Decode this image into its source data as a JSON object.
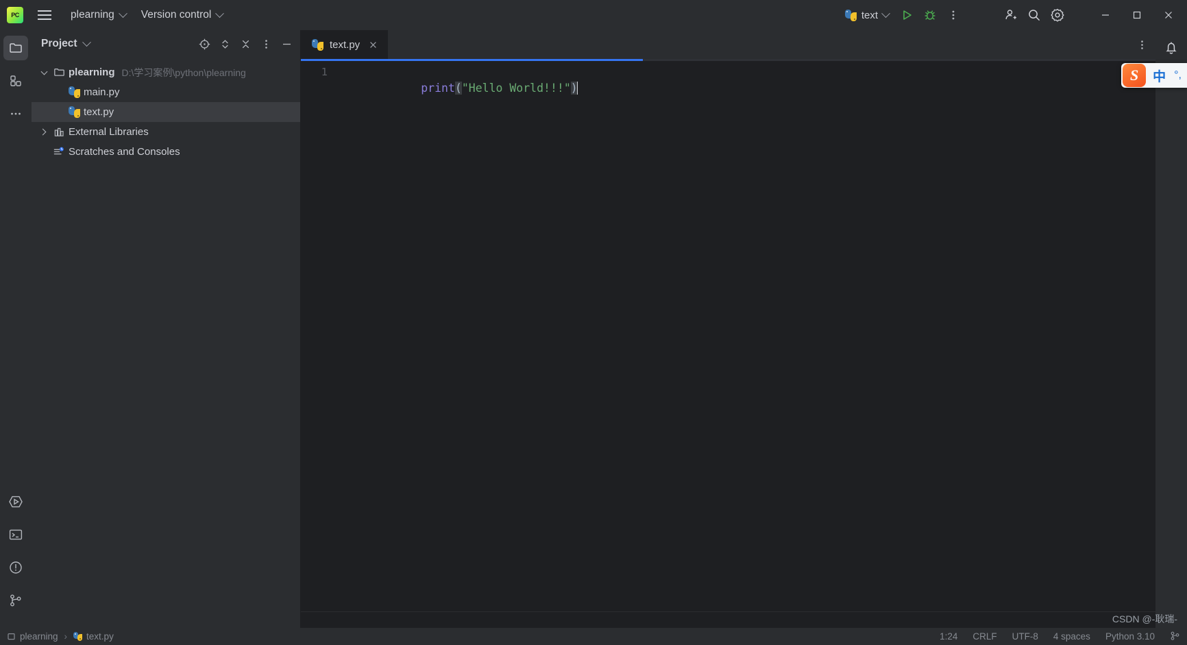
{
  "titlebar": {
    "logo_text": "PC",
    "menu_icon": "hamburger-icon",
    "project_name": "plearning",
    "version_control": "Version control",
    "run_config": "text",
    "run_icon": "run-triangle-icon",
    "debug_icon": "debug-bug-icon",
    "more_icon": "vertical-dots-icon",
    "account_icon": "add-user-icon",
    "search_icon": "search-icon",
    "settings_icon": "gear-icon",
    "minimize": "minimize-icon",
    "maximize": "maximize-icon",
    "close": "close-icon"
  },
  "rail": {
    "project_icon": "folder-icon",
    "structure_icon": "structure-grid-icon",
    "more_icon": "ellipsis-icon",
    "run_icon": "run-hexagon-icon",
    "terminal_icon": "terminal-icon",
    "problems_icon": "problems-warning-icon",
    "vcs_icon": "version-control-branch-icon"
  },
  "panel": {
    "title": "Project",
    "actions": {
      "locate": "target-locate-icon",
      "expand": "expand-collapse-icon",
      "collapse_all": "collapse-all-icon",
      "options": "vertical-dots-icon",
      "hide": "minimize-dash-icon"
    },
    "tree": [
      {
        "label": "plearning",
        "path": "D:\\学习案例\\python\\plearning",
        "icon": "folder-icon",
        "state": "expanded",
        "depth": 0,
        "selected": false
      },
      {
        "label": "main.py",
        "path": "",
        "icon": "python-file-icon",
        "state": "leaf",
        "depth": 1,
        "selected": false
      },
      {
        "label": "text.py",
        "path": "",
        "icon": "python-file-icon",
        "state": "leaf",
        "depth": 1,
        "selected": true
      },
      {
        "label": "External Libraries",
        "path": "",
        "icon": "library-icon",
        "state": "collapsed",
        "depth": 0,
        "selected": false
      },
      {
        "label": "Scratches and Consoles",
        "path": "",
        "icon": "scratches-icon",
        "state": "leaf",
        "depth": 0,
        "selected": false
      }
    ]
  },
  "editor": {
    "tab": {
      "label": "text.py",
      "icon": "python-file-icon",
      "close": "close-icon"
    },
    "tab_options_icon": "vertical-dots-icon",
    "progress_percent": 40,
    "lines": [
      {
        "number": "1",
        "tokens": [
          {
            "text": "print",
            "type": "function"
          },
          {
            "text": "(",
            "type": "paren"
          },
          {
            "text": "\"Hello World!!!\"",
            "type": "string"
          },
          {
            "text": ")",
            "type": "paren"
          }
        ]
      }
    ]
  },
  "notifications": {
    "icon": "bell-icon"
  },
  "statusbar": {
    "breadcrumb": [
      "plearning",
      "text.py"
    ],
    "separator": "›",
    "position": "1:24",
    "line_separator": "CRLF",
    "encoding": "UTF-8",
    "indent": "4 spaces",
    "interpreter": "Python 3.10",
    "branch_icon": "branch-icon"
  },
  "ime": {
    "logo": "S",
    "mode": "中",
    "punctuation": "°,"
  },
  "watermark": "CSDN @-耿瑞-"
}
